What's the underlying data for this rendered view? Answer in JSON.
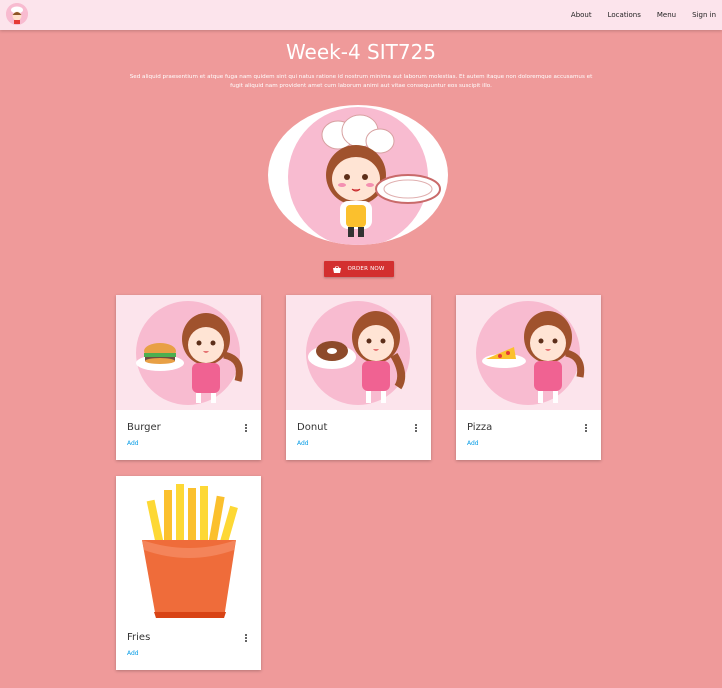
{
  "navbar": {
    "links": [
      "About",
      "Locations",
      "Menu",
      "Sign in"
    ]
  },
  "hero": {
    "title": "Week-4 SIT725",
    "text_line1": "Sed aliquid praesentium et atque fuga nam quidem sint qui natus ratione id nostrum minima aut laborum molestias. Et autem itaque non doloremque accusamus et",
    "text_line2": "fugit aliquid nam provident amet cum laborum animi aut vitae consequuntur eos suscipit illo.",
    "button_label": "ORDER NOW"
  },
  "cards": [
    {
      "title": "Burger",
      "link": "Add",
      "image": "girl-with-burger"
    },
    {
      "title": "Donut",
      "link": "Add",
      "image": "girl-with-donut"
    },
    {
      "title": "Pizza",
      "link": "Add",
      "image": "girl-with-pizza"
    },
    {
      "title": "Fries",
      "link": "Add",
      "image": "fries"
    }
  ],
  "colors": {
    "background": "#ef9a9a",
    "navbar": "#fce4ec",
    "button": "#d32f2f",
    "link": "#039be5"
  }
}
